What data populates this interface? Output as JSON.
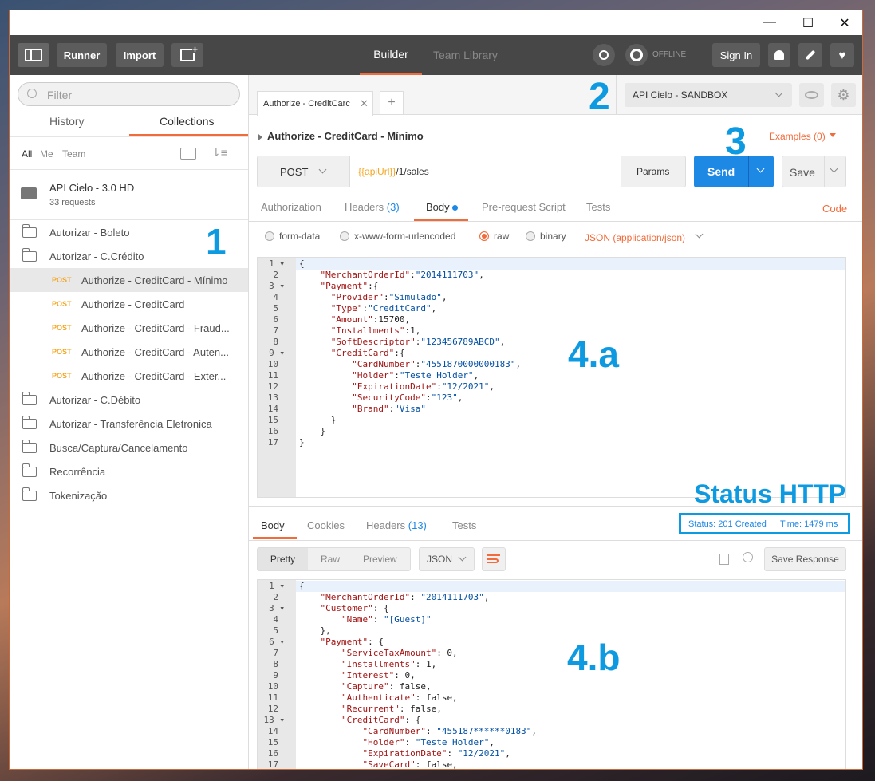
{
  "window": {
    "minimize": "—",
    "maximize": "☐",
    "close": "✕"
  },
  "toolbar": {
    "runner": "Runner",
    "import": "Import",
    "tabs": [
      "Builder",
      "Team Library"
    ],
    "offline": "OFFLINE",
    "signin": "Sign In"
  },
  "sidebar": {
    "filter_placeholder": "Filter",
    "tabs": [
      "History",
      "Collections"
    ],
    "filters": [
      "All",
      "Me",
      "Team"
    ],
    "collection": {
      "name": "API Cielo - 3.0 HD",
      "count": "33 requests"
    },
    "folders": [
      "Autorizar - Boleto",
      "Autorizar - C.Crédito"
    ],
    "requests": [
      {
        "method": "POST",
        "name": "Authorize - CreditCard - Mínimo"
      },
      {
        "method": "POST",
        "name": "Authorize - CreditCard"
      },
      {
        "method": "POST",
        "name": "Authorize - CreditCard - Fraud..."
      },
      {
        "method": "POST",
        "name": "Authorize - CreditCard - Auten..."
      },
      {
        "method": "POST",
        "name": "Authorize - CreditCard - Exter..."
      }
    ],
    "folders2": [
      "Autorizar - C.Débito",
      "Autorizar - Transferência Eletronica",
      "Busca/Captura/Cancelamento",
      "Recorrência",
      "Tokenização"
    ]
  },
  "request": {
    "tab_label": "Authorize - CreditCarc",
    "environment": "API Cielo - SANDBOX",
    "title": "Authorize - CreditCard - Mínimo",
    "examples": "Examples (0)",
    "method": "POST",
    "url_var": "{{apiUrl}}",
    "url_path": "/1/sales",
    "params": "Params",
    "send": "Send",
    "save": "Save",
    "subtabs": [
      "Authorization",
      "Headers",
      "(3)",
      "Body",
      "Pre-request Script",
      "Tests"
    ],
    "code": "Code",
    "body_types": [
      "form-data",
      "x-www-form-urlencoded",
      "raw",
      "binary"
    ],
    "content_type": "JSON (application/json)"
  },
  "request_body": [
    [
      [
        "p",
        "{"
      ]
    ],
    [
      [
        "k",
        "    \"MerchantOrderId\""
      ],
      [
        "p",
        ":"
      ],
      [
        "s",
        "\"2014111703\""
      ],
      [
        "p",
        ","
      ]
    ],
    [
      [
        "k",
        "    \"Payment\""
      ],
      [
        "p",
        ":{"
      ]
    ],
    [
      [
        "k",
        "      \"Provider\""
      ],
      [
        "p",
        ":"
      ],
      [
        "s",
        "\"Simulado\""
      ],
      [
        "p",
        ","
      ]
    ],
    [
      [
        "k",
        "      \"Type\""
      ],
      [
        "p",
        ":"
      ],
      [
        "s",
        "\"CreditCard\""
      ],
      [
        "p",
        ","
      ]
    ],
    [
      [
        "k",
        "      \"Amount\""
      ],
      [
        "p",
        ":15700,"
      ]
    ],
    [
      [
        "k",
        "      \"Installments\""
      ],
      [
        "p",
        ":1,"
      ]
    ],
    [
      [
        "k",
        "      \"SoftDescriptor\""
      ],
      [
        "p",
        ":"
      ],
      [
        "s",
        "\"123456789ABCD\""
      ],
      [
        "p",
        ","
      ]
    ],
    [
      [
        "k",
        "      \"CreditCard\""
      ],
      [
        "p",
        ":{"
      ]
    ],
    [
      [
        "k",
        "          \"CardNumber\""
      ],
      [
        "p",
        ":"
      ],
      [
        "s",
        "\"4551870000000183\""
      ],
      [
        "p",
        ","
      ]
    ],
    [
      [
        "k",
        "          \"Holder\""
      ],
      [
        "p",
        ":"
      ],
      [
        "s",
        "\"Teste Holder\""
      ],
      [
        "p",
        ","
      ]
    ],
    [
      [
        "k",
        "          \"ExpirationDate\""
      ],
      [
        "p",
        ":"
      ],
      [
        "s",
        "\"12/2021\""
      ],
      [
        "p",
        ","
      ]
    ],
    [
      [
        "k",
        "          \"SecurityCode\""
      ],
      [
        "p",
        ":"
      ],
      [
        "s",
        "\"123\""
      ],
      [
        "p",
        ","
      ]
    ],
    [
      [
        "k",
        "          \"Brand\""
      ],
      [
        "p",
        ":"
      ],
      [
        "s",
        "\"Visa\""
      ]
    ],
    [
      [
        "p",
        "      }"
      ]
    ],
    [
      [
        "p",
        "    }"
      ]
    ],
    [
      [
        "p",
        "}"
      ]
    ]
  ],
  "response": {
    "tabs": [
      "Body",
      "Cookies",
      "Headers",
      "(13)",
      "Tests"
    ],
    "status": "Status: 201 Created",
    "time": "Time: 1479 ms",
    "views": [
      "Pretty",
      "Raw",
      "Preview"
    ],
    "format": "JSON",
    "save_response": "Save Response"
  },
  "response_body": [
    [
      [
        "p",
        "{"
      ]
    ],
    [
      [
        "k",
        "    \"MerchantOrderId\""
      ],
      [
        "p",
        ": "
      ],
      [
        "s",
        "\"2014111703\""
      ],
      [
        "p",
        ","
      ]
    ],
    [
      [
        "k",
        "    \"Customer\""
      ],
      [
        "p",
        ": {"
      ]
    ],
    [
      [
        "k",
        "        \"Name\""
      ],
      [
        "p",
        ": "
      ],
      [
        "s",
        "\"[Guest]\""
      ]
    ],
    [
      [
        "p",
        "    },"
      ]
    ],
    [
      [
        "k",
        "    \"Payment\""
      ],
      [
        "p",
        ": {"
      ]
    ],
    [
      [
        "k",
        "        \"ServiceTaxAmount\""
      ],
      [
        "p",
        ": 0,"
      ]
    ],
    [
      [
        "k",
        "        \"Installments\""
      ],
      [
        "p",
        ": 1,"
      ]
    ],
    [
      [
        "k",
        "        \"Interest\""
      ],
      [
        "p",
        ": 0,"
      ]
    ],
    [
      [
        "k",
        "        \"Capture\""
      ],
      [
        "p",
        ": false,"
      ]
    ],
    [
      [
        "k",
        "        \"Authenticate\""
      ],
      [
        "p",
        ": false,"
      ]
    ],
    [
      [
        "k",
        "        \"Recurrent\""
      ],
      [
        "p",
        ": false,"
      ]
    ],
    [
      [
        "k",
        "        \"CreditCard\""
      ],
      [
        "p",
        ": {"
      ]
    ],
    [
      [
        "k",
        "            \"CardNumber\""
      ],
      [
        "p",
        ": "
      ],
      [
        "s",
        "\"455187******0183\""
      ],
      [
        "p",
        ","
      ]
    ],
    [
      [
        "k",
        "            \"Holder\""
      ],
      [
        "p",
        ": "
      ],
      [
        "s",
        "\"Teste Holder\""
      ],
      [
        "p",
        ","
      ]
    ],
    [
      [
        "k",
        "            \"ExpirationDate\""
      ],
      [
        "p",
        ": "
      ],
      [
        "s",
        "\"12/2021\""
      ],
      [
        "p",
        ","
      ]
    ],
    [
      [
        "k",
        "            \"SaveCard\""
      ],
      [
        "p",
        ": false,"
      ]
    ]
  ],
  "annotations": {
    "a1": "1",
    "a2": "2",
    "a3": "3",
    "a4a": "4.a",
    "a4b": "4.b",
    "status": "Status HTTP"
  },
  "colors": {
    "accent": "#f26b3a",
    "send": "#1e88e5",
    "annotation": "#0d9ae0",
    "post": "#f5a623"
  }
}
